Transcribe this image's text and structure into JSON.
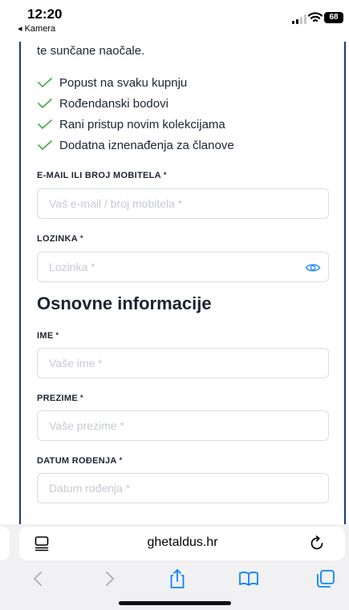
{
  "status_bar": {
    "time": "12:20",
    "back_label": "◂ Kamera",
    "battery": "68"
  },
  "intro_text": "te sunčane naočale.",
  "benefits": [
    "Popust na svaku kupnju",
    "Rođendanski bodovi",
    "Rani pristup novim kolekcijama",
    "Dodatna iznenađenja za članove"
  ],
  "fields": {
    "email": {
      "label": "E-MAIL ILI BROJ MOBITELA",
      "placeholder": "Vaš e-mail / broj mobitela *"
    },
    "password": {
      "label": "LOZINKA",
      "placeholder": "Lozinka *"
    },
    "first_name": {
      "label": "IME",
      "placeholder": "Vaše ime *"
    },
    "last_name": {
      "label": "PREZIME",
      "placeholder": "Vaše prezime *"
    },
    "birth_date": {
      "label": "DATUM ROĐENJA",
      "placeholder": "Datum rođenja *"
    }
  },
  "required_mark": "*",
  "section_title": "Osnovne informacije",
  "browser": {
    "url": "ghetaldus.hr"
  },
  "icons": {
    "check": "check-icon",
    "eye": "eye-icon",
    "page-menu": "page-menu-icon",
    "reload": "reload-icon",
    "back": "chevron-left-icon",
    "forward": "chevron-right-icon",
    "share": "share-icon",
    "bookmarks": "book-icon",
    "tabs": "tabs-icon"
  },
  "colors": {
    "accent": "#0a84ff",
    "check_green": "#4caf50",
    "panel_border": "#1c3b7a",
    "eye": "#2d8cff"
  }
}
